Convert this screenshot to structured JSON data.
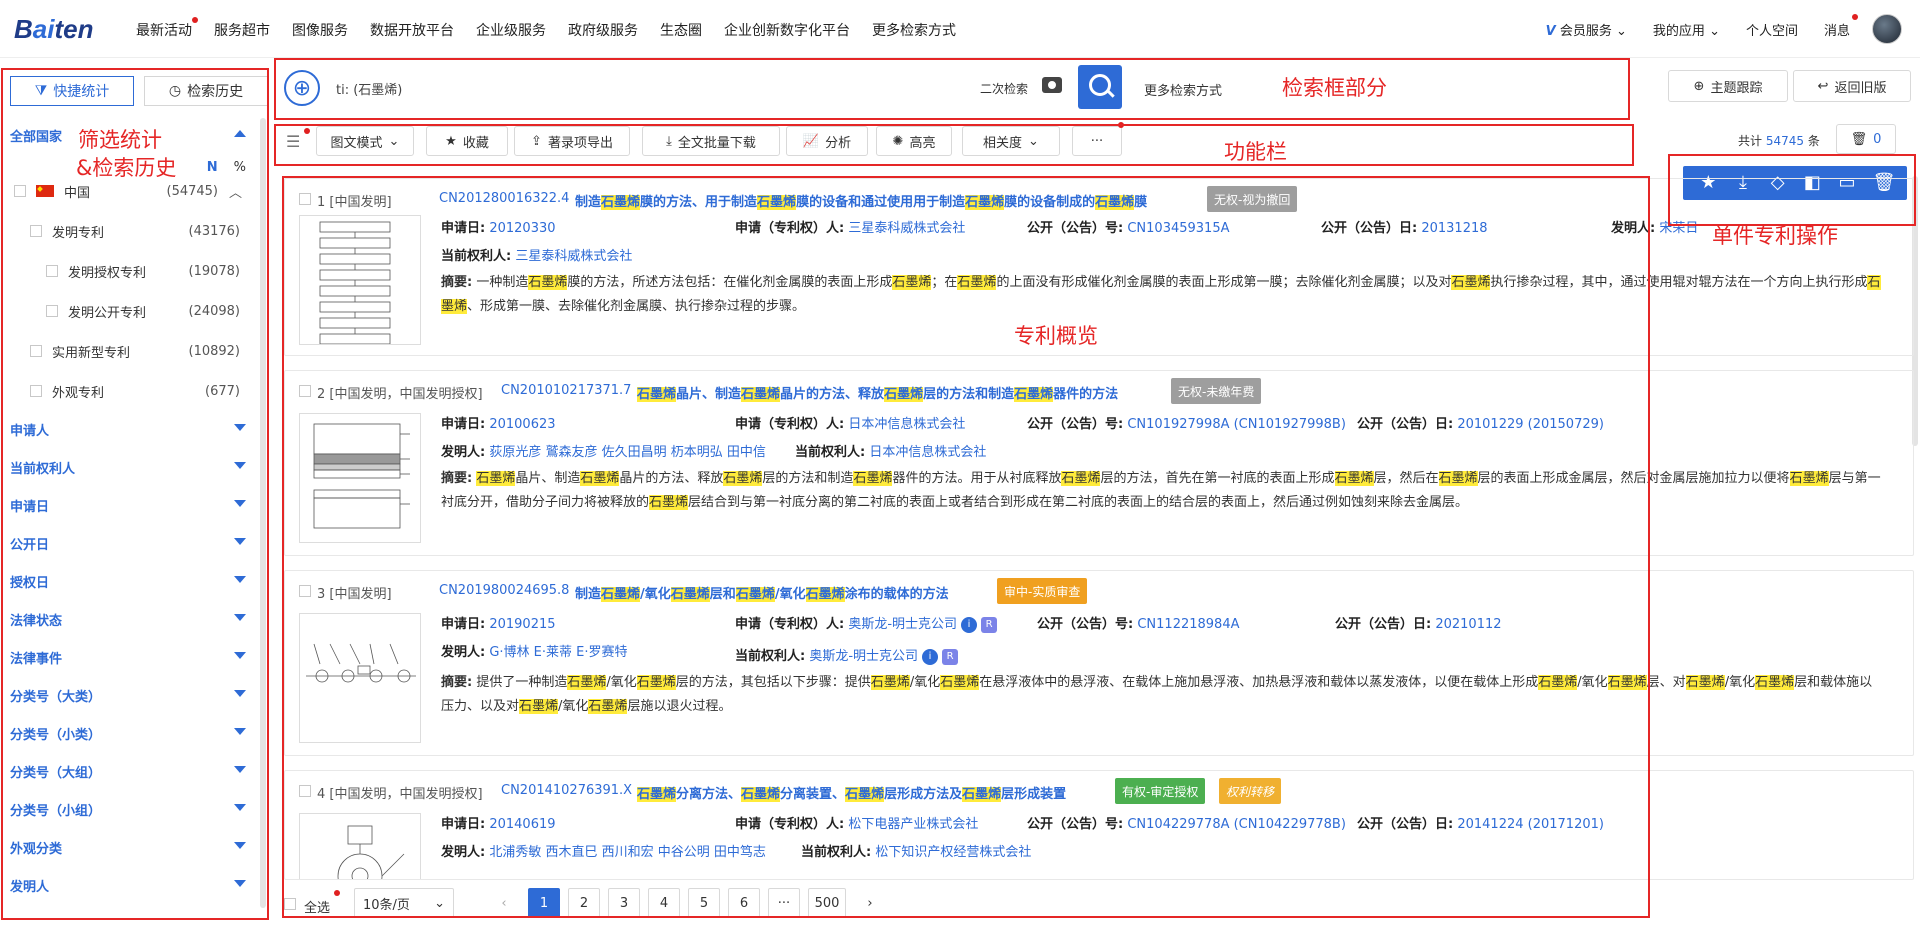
{
  "nav": {
    "logo_pre": "B",
    "logo_ai": "ai",
    "logo_post": "ten",
    "items": [
      "最新活动",
      "服务超市",
      "图像服务",
      "数据开放平台",
      "企业级服务",
      "政府级服务",
      "生态圈",
      "企业创新数字化平台",
      "更多检索方式"
    ],
    "vip": "会员服务",
    "apps": "我的应用",
    "space": "个人空间",
    "msg": "消息"
  },
  "sidebar": {
    "tab_stats": "快捷统计",
    "tab_history": "检索历史",
    "all_country": "全部国家",
    "n_label": "N",
    "pct_label": "%",
    "china": {
      "label": "中国",
      "count": "(54745)"
    },
    "sub": [
      {
        "label": "发明专利",
        "count": "(43176)"
      },
      {
        "label": "发明授权专利",
        "count": "(19078)"
      },
      {
        "label": "发明公开专利",
        "count": "(24098)"
      },
      {
        "label": "实用新型专利",
        "count": "(10892)"
      },
      {
        "label": "外观专利",
        "count": "(677)"
      }
    ],
    "groups": [
      "申请人",
      "当前权利人",
      "申请日",
      "公开日",
      "授权日",
      "法律状态",
      "法律事件",
      "分类号（大类）",
      "分类号（小类）",
      "分类号（大组）",
      "分类号（小组）",
      "外观分类",
      "发明人"
    ]
  },
  "search": {
    "query": "ti: (石墨烯)",
    "secondary": "二次检索",
    "more": "更多检索方式",
    "topic_track": "主题跟踪",
    "back_old": "返回旧版"
  },
  "toolbar": {
    "mode": "图文模式",
    "fav": "收藏",
    "export": "著录项导出",
    "download": "全文批量下载",
    "analyze": "分析",
    "highlight": "高亮",
    "sort": "相关度",
    "more": "···",
    "total_pre": "共计",
    "total_num": "54745",
    "total_post": "条",
    "trash_count": "0"
  },
  "annotations": {
    "search_box": "检索框部分",
    "filter": "筛选统计",
    "filter2": "&检索历史",
    "functions": "功能栏",
    "single_ops": "单件专利操作",
    "overview": "专利概览"
  },
  "labels": {
    "apply_date": "申请日:",
    "applicant": "申请（专利权）人:",
    "pub_no": "公开（公告）号:",
    "pub_date": "公开（公告）日:",
    "inventor": "发明人:",
    "owner": "当前权利人:",
    "abstract": "摘要:"
  },
  "records": [
    {
      "num": "1 [中国发明]",
      "pno": "CN201280016322.4",
      "title": "制造石墨烯膜的方法、用于制造石墨烯膜的设备和通过使用用于制造石墨烯膜的设备制成的石墨烯膜",
      "badge": "无权-视为撤回",
      "badge_color": "#9e9e9e",
      "apply_date": "20120330",
      "applicant": "三星泰科威株式会社",
      "pub_no": "CN103459315A",
      "pub_date": "20131218",
      "inventor": "宋荣日",
      "owner": "三星泰科威株式会社",
      "abstract": "一种制造石墨烯膜的方法，所述方法包括：在催化剂金属膜的表面上形成石墨烯；在石墨烯的上面没有形成催化剂金属膜的表面上形成第一膜；去除催化剂金属膜；以及对石墨烯执行掺杂过程，其中，通过使用辊对辊方法在一个方向上执行形成石墨烯、形成第一膜、去除催化剂金属膜、执行掺杂过程的步骤。"
    },
    {
      "num": "2 [中国发明，中国发明授权]",
      "pno": "CN201010217371.7",
      "title": "石墨烯晶片、制造石墨烯晶片的方法、释放石墨烯层的方法和制造石墨烯器件的方法",
      "badge": "无权-未缴年费",
      "badge_color": "#9e9e9e",
      "apply_date": "20100623",
      "applicant": "日本冲信息株式会社",
      "pub_no": "CN101927998A (CN101927998B)",
      "pub_date": "20101229 (20150729)",
      "inventor": "荻原光彦 鷲森友彦 佐久田昌明 杤本明弘 田中信",
      "owner": "日本冲信息株式会社",
      "abstract": "石墨烯晶片、制造石墨烯晶片的方法、释放石墨烯层的方法和制造石墨烯器件的方法。用于从衬底释放石墨烯层的方法，首先在第一衬底的表面上形成石墨烯层，然后在石墨烯层的表面上形成金属层，然后对金属层施加拉力以便将石墨烯层与第一衬底分开，借助分子间力将被释放的石墨烯层结合到与第一衬底分离的第二衬底的表面上或者结合到形成在第二衬底的表面上的结合层的表面上，然后通过例如蚀刻来除去金属层。"
    },
    {
      "num": "3 [中国发明]",
      "pno": "CN201980024695.8",
      "title": "制造石墨烯/氧化石墨烯层和石墨烯/氧化石墨烯涂布的载体的方法",
      "badge": "审中-实质审查",
      "badge_color": "#f0a020",
      "apply_date": "20190215",
      "applicant": "奥斯龙-明士克公司",
      "pub_no": "CN112218984A",
      "pub_date": "20210112",
      "inventor": "G·博林 E·莱蒂 E·罗赛特",
      "owner": "奥斯龙-明士克公司",
      "abstract": "提供了一种制造石墨烯/氧化石墨烯层的方法，其包括以下步骤：提供石墨烯/氧化石墨烯在悬浮液体中的悬浮液、在载体上施加悬浮液、加热悬浮液和载体以蒸发液体，以便在载体上形成石墨烯/氧化石墨烯层、对石墨烯/氧化石墨烯层和载体施以压力、以及对石墨烯/氧化石墨烯层施以退火过程。"
    },
    {
      "num": "4 [中国发明，中国发明授权]",
      "pno": "CN201410276391.X",
      "title": "石墨烯分离方法、石墨烯分离装置、石墨烯层形成方法及石墨烯层形成装置",
      "badge": "有权-审定授权",
      "badge_color": "#4caf50",
      "badge2": "权利转移",
      "badge2_color": "#f0b030",
      "apply_date": "20140619",
      "applicant": "松下电器产业株式会社",
      "pub_no": "CN104229778A (CN104229778B)",
      "pub_date": "20141224 (20171201)",
      "inventor": "北浦秀敏 西木直巳 西川和宏 中谷公明 田中笃志",
      "owner": "松下知识产权经营株式会社"
    }
  ],
  "pager": {
    "select_all": "全选",
    "per_page": "10条/页",
    "prev": "‹",
    "pages": [
      "1",
      "2",
      "3",
      "4",
      "5",
      "6"
    ],
    "ellipsis": "···",
    "last": "500",
    "next": "›"
  },
  "ops_icons": [
    "star-icon",
    "download-icon",
    "gem-icon",
    "compare-icon",
    "monitor-icon",
    "trash-icon"
  ]
}
